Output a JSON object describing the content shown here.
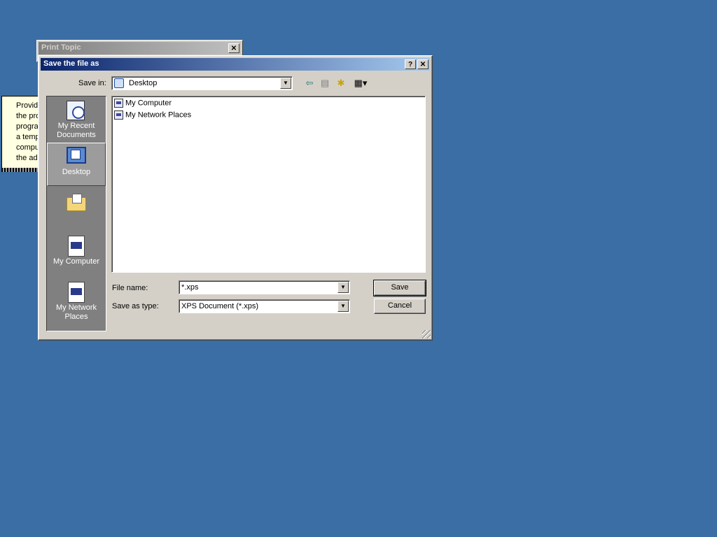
{
  "help_popup": {
    "text": "Provid\nthe pro\nprogra\na tempe\ncompu\nthe add"
  },
  "print_window": {
    "title": "Print Topic",
    "close_glyph": "✕"
  },
  "dialog": {
    "title": "Save the file as",
    "help_glyph": "?",
    "close_glyph": "✕",
    "save_in_label": "Save in:",
    "save_in_value": "Desktop",
    "places": [
      {
        "label": "My Recent Documents",
        "icon": "recent-documents-icon"
      },
      {
        "label": "Desktop",
        "icon": "desktop-icon"
      },
      {
        "label": "",
        "icon": "my-documents-folder-icon"
      },
      {
        "label": "My Computer",
        "icon": "my-computer-icon"
      },
      {
        "label": "My Network Places",
        "icon": "my-network-places-icon"
      }
    ],
    "files": [
      {
        "name": "My Computer",
        "icon": "my-computer-icon"
      },
      {
        "name": "My Network Places",
        "icon": "my-network-places-icon"
      }
    ],
    "file_name_label": "File name:",
    "file_name_value": "*.xps",
    "save_type_label": "Save as type:",
    "save_type_value": "XPS Document (*.xps)",
    "save_button": "Save",
    "cancel_button": "Cancel",
    "dropdown_glyph": "▼",
    "toolbar": {
      "back": "⇦",
      "up": "▤",
      "new_folder": "✱",
      "views": "▦▾"
    }
  },
  "colors": {
    "desktop": "#3a6ea5",
    "title_active": "#0a246a",
    "title_inactive": "#808080"
  }
}
